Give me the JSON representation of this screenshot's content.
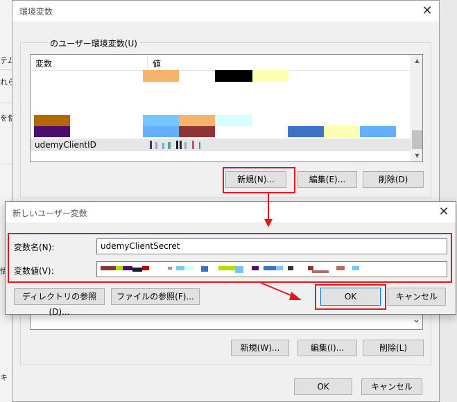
{
  "background_window": {
    "fragments": [
      "テムの",
      "れら",
      "を使用",
      "情",
      "キ"
    ]
  },
  "env_dialog": {
    "title": "環境変数",
    "close_glyph": "✕",
    "user_group_label": "のユーザー環境変数(U)",
    "columns": [
      "変数",
      "値"
    ],
    "selected_row_name": "udemyClientID",
    "buttons": {
      "new": "新規(N)...",
      "edit": "編集(E)...",
      "delete": "削除(D)"
    },
    "system_buttons": {
      "new": "新規(W)...",
      "edit": "編集(I)...",
      "delete": "削除(L)"
    },
    "ok": "OK",
    "cancel": "キャンセル",
    "dropdown_glyph": "⌄"
  },
  "new_var_dialog": {
    "title": "新しいユーザー変数",
    "close_glyph": "✕",
    "name_label": "変数名(N):",
    "value_label": "変数値(V):",
    "name_value": "udemyClientSecret",
    "browse_dir": "ディレクトリの参照(D)...",
    "browse_file": "ファイルの参照(F)...",
    "ok": "OK",
    "cancel": "キャンセル"
  },
  "colors": {
    "highlight": "#e0171f",
    "redaction_orange": "#f5b46a",
    "redaction_black": "#000000",
    "redaction_yellow": "#ffffb4",
    "redaction_brown": "#b26a00",
    "redaction_purple": "#4b0f6b",
    "redaction_lightblue": "#75c6ff",
    "redaction_cyan": "#d6ffff",
    "redaction_maroon": "#8e3434",
    "redaction_blue": "#3f72c4",
    "redaction_skyblue": "#64b0ff"
  }
}
